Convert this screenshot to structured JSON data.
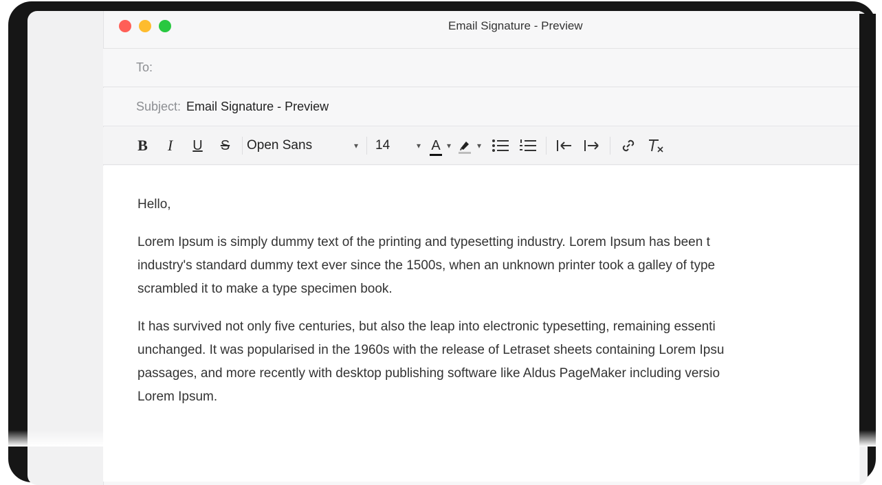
{
  "window": {
    "title": "Email Signature - Preview"
  },
  "fields": {
    "to_label": "To:",
    "to_value": "",
    "subject_label": "Subject:",
    "subject_value": "Email Signature - Preview"
  },
  "toolbar": {
    "bold_label": "B",
    "italic_label": "I",
    "underline_label": "U",
    "strike_label": "S",
    "font_family": "Open Sans",
    "font_size": "14",
    "text_color_label": "A",
    "caret": "▾",
    "icons": [
      "bold-icon",
      "italic-icon",
      "underline-icon",
      "strikethrough-icon",
      "text-color-icon",
      "highlight-icon",
      "bulleted-list-icon",
      "numbered-list-icon",
      "outdent-icon",
      "indent-icon",
      "link-icon",
      "clear-formatting-icon"
    ]
  },
  "message": {
    "greeting": "Hello,",
    "paragraph1": [
      "Lorem Ipsum is simply dummy text of the printing and typesetting industry. Lorem Ipsum has been t",
      "industry's standard dummy text ever since the 1500s, when an unknown printer took a galley of type",
      "scrambled it to make a type specimen book."
    ],
    "paragraph2": [
      "It has survived not only five centuries, but also the leap into electronic typesetting, remaining essenti",
      "unchanged. It was popularised in the 1960s with the release of Letraset sheets containing Lorem Ipsu",
      "passages, and more recently with desktop publishing software like Aldus PageMaker including versio",
      "Lorem Ipsum."
    ]
  },
  "colors": {
    "close": "#ff5f57",
    "minimize": "#febc2e",
    "zoom": "#28c840",
    "bezel": "#161616"
  }
}
